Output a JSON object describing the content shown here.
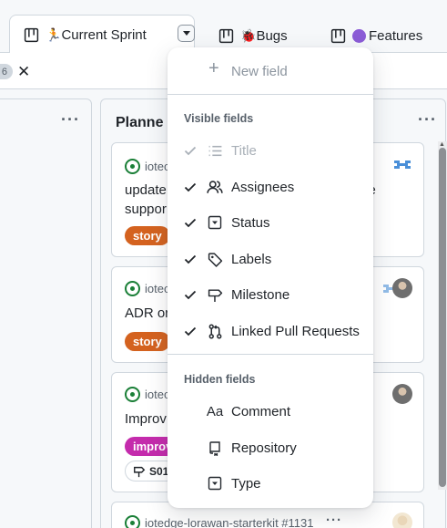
{
  "tabs": [
    {
      "label": "Current Sprint",
      "emoji": "🏃",
      "active": true
    },
    {
      "label": "Bugs",
      "emoji": "🐞",
      "active": false
    },
    {
      "label": "Features",
      "emoji_color": "#8b5cd6",
      "active": false
    }
  ],
  "filter": {
    "count": "6",
    "clear_icon": "x-icon"
  },
  "column": {
    "title": "Planned",
    "title_visible": "Planne"
  },
  "cards": [
    {
      "repo": "iotec",
      "title": "update",
      "title_line2": "suppor",
      "title_tail": "ce",
      "label": "story",
      "label_color": "#d4621f"
    },
    {
      "repo": "iotec",
      "title": "ADR or",
      "label": "story",
      "label_color": "#d4621f"
    },
    {
      "repo": "iotec",
      "title": "Improv",
      "label": "improv",
      "label_color": "#c42bac",
      "milestone": "S01"
    },
    {
      "repo": "iotedge-lorawan-starterkit #1131"
    }
  ],
  "menu": {
    "new_field": "New field",
    "visible_header": "Visible fields",
    "visible": [
      {
        "label": "Title",
        "icon": "list-icon",
        "checked": true,
        "disabled": true
      },
      {
        "label": "Assignees",
        "icon": "people-icon",
        "checked": true
      },
      {
        "label": "Status",
        "icon": "single-select-icon",
        "checked": true
      },
      {
        "label": "Labels",
        "icon": "tag-icon",
        "checked": true
      },
      {
        "label": "Milestone",
        "icon": "milestone-icon",
        "checked": true
      },
      {
        "label": "Linked Pull Requests",
        "icon": "pull-request-icon",
        "checked": true
      }
    ],
    "hidden_header": "Hidden fields",
    "hidden": [
      {
        "label": "Comment",
        "icon": "text-icon",
        "glyph": "Aa"
      },
      {
        "label": "Repository",
        "icon": "repo-icon"
      },
      {
        "label": "Type",
        "icon": "single-select-icon"
      }
    ]
  },
  "colors": {
    "accent_green": "#1a7f37",
    "story": "#d4621f",
    "improvement": "#c42bac",
    "features_dot": "#8b5cd6"
  }
}
